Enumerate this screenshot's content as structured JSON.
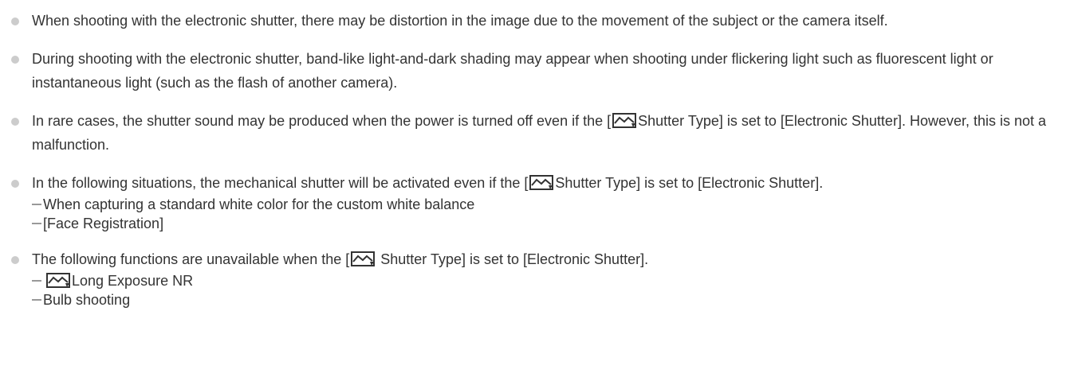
{
  "notes": [
    {
      "text": "When shooting with the electronic shutter, there may be distortion in the image due to the movement of the subject or the camera itself."
    },
    {
      "text": "During shooting with the electronic shutter, band-like light-and-dark shading may appear when shooting under flickering light such as fluorescent light or instantaneous light (such as the flash of another camera)."
    },
    {
      "before": "In rare cases, the shutter sound may be produced when the power is turned off even if the [",
      "after": "Shutter Type] is set to [Electronic Shutter]. However, this is not a malfunction."
    },
    {
      "before": "In the following situations, the mechanical shutter will be activated even if the [",
      "after": "Shutter Type] is set to [Electronic Shutter].",
      "subitems": [
        "When capturing a standard white color for the custom white balance",
        "[Face Registration]"
      ]
    },
    {
      "before": "The following functions are unavailable when the [",
      "after": " Shutter Type] is set to [Electronic Shutter].",
      "subitems": [
        "Long Exposure NR",
        "Bulb shooting"
      ]
    }
  ],
  "icon": {
    "name": "still-image-shooting-icon"
  },
  "colors": {
    "text": "#333333",
    "bullet": "#cccccc",
    "dash": "#999999"
  }
}
